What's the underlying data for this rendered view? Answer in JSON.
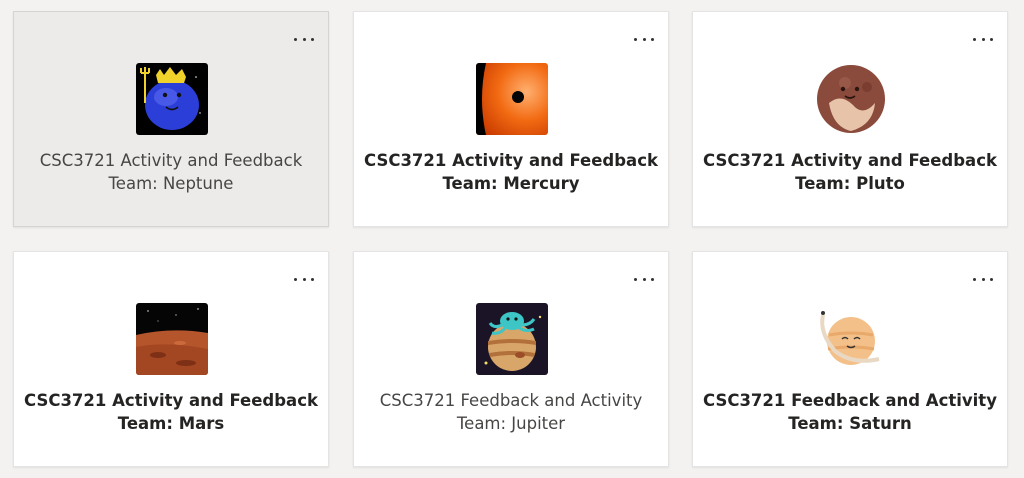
{
  "teams": [
    {
      "title": "CSC3721 Activity and Feedback",
      "subtitle": "Team: Neptune",
      "icon": "neptune-avatar-icon",
      "bold": false
    },
    {
      "title": "CSC3721 Activity and Feedback",
      "subtitle": "Team: Mercury",
      "icon": "mercury-avatar-icon",
      "bold": true
    },
    {
      "title": "CSC3721 Activity and Feedback",
      "subtitle": "Team: Pluto",
      "icon": "pluto-avatar-icon",
      "bold": true
    },
    {
      "title": "CSC3721 Activity and Feedback",
      "subtitle": "Team: Mars",
      "icon": "mars-avatar-icon",
      "bold": true
    },
    {
      "title": "CSC3721 Feedback and Activity",
      "subtitle": "Team: Jupiter",
      "icon": "jupiter-avatar-icon",
      "bold": false
    },
    {
      "title": "CSC3721 Feedback and Activity",
      "subtitle": "Team: Saturn",
      "icon": "saturn-avatar-icon",
      "bold": true
    }
  ],
  "colors": {
    "background": "#f3f2f1",
    "card": "#ffffff",
    "card_hover": "#edebe9",
    "text": "#252423"
  }
}
